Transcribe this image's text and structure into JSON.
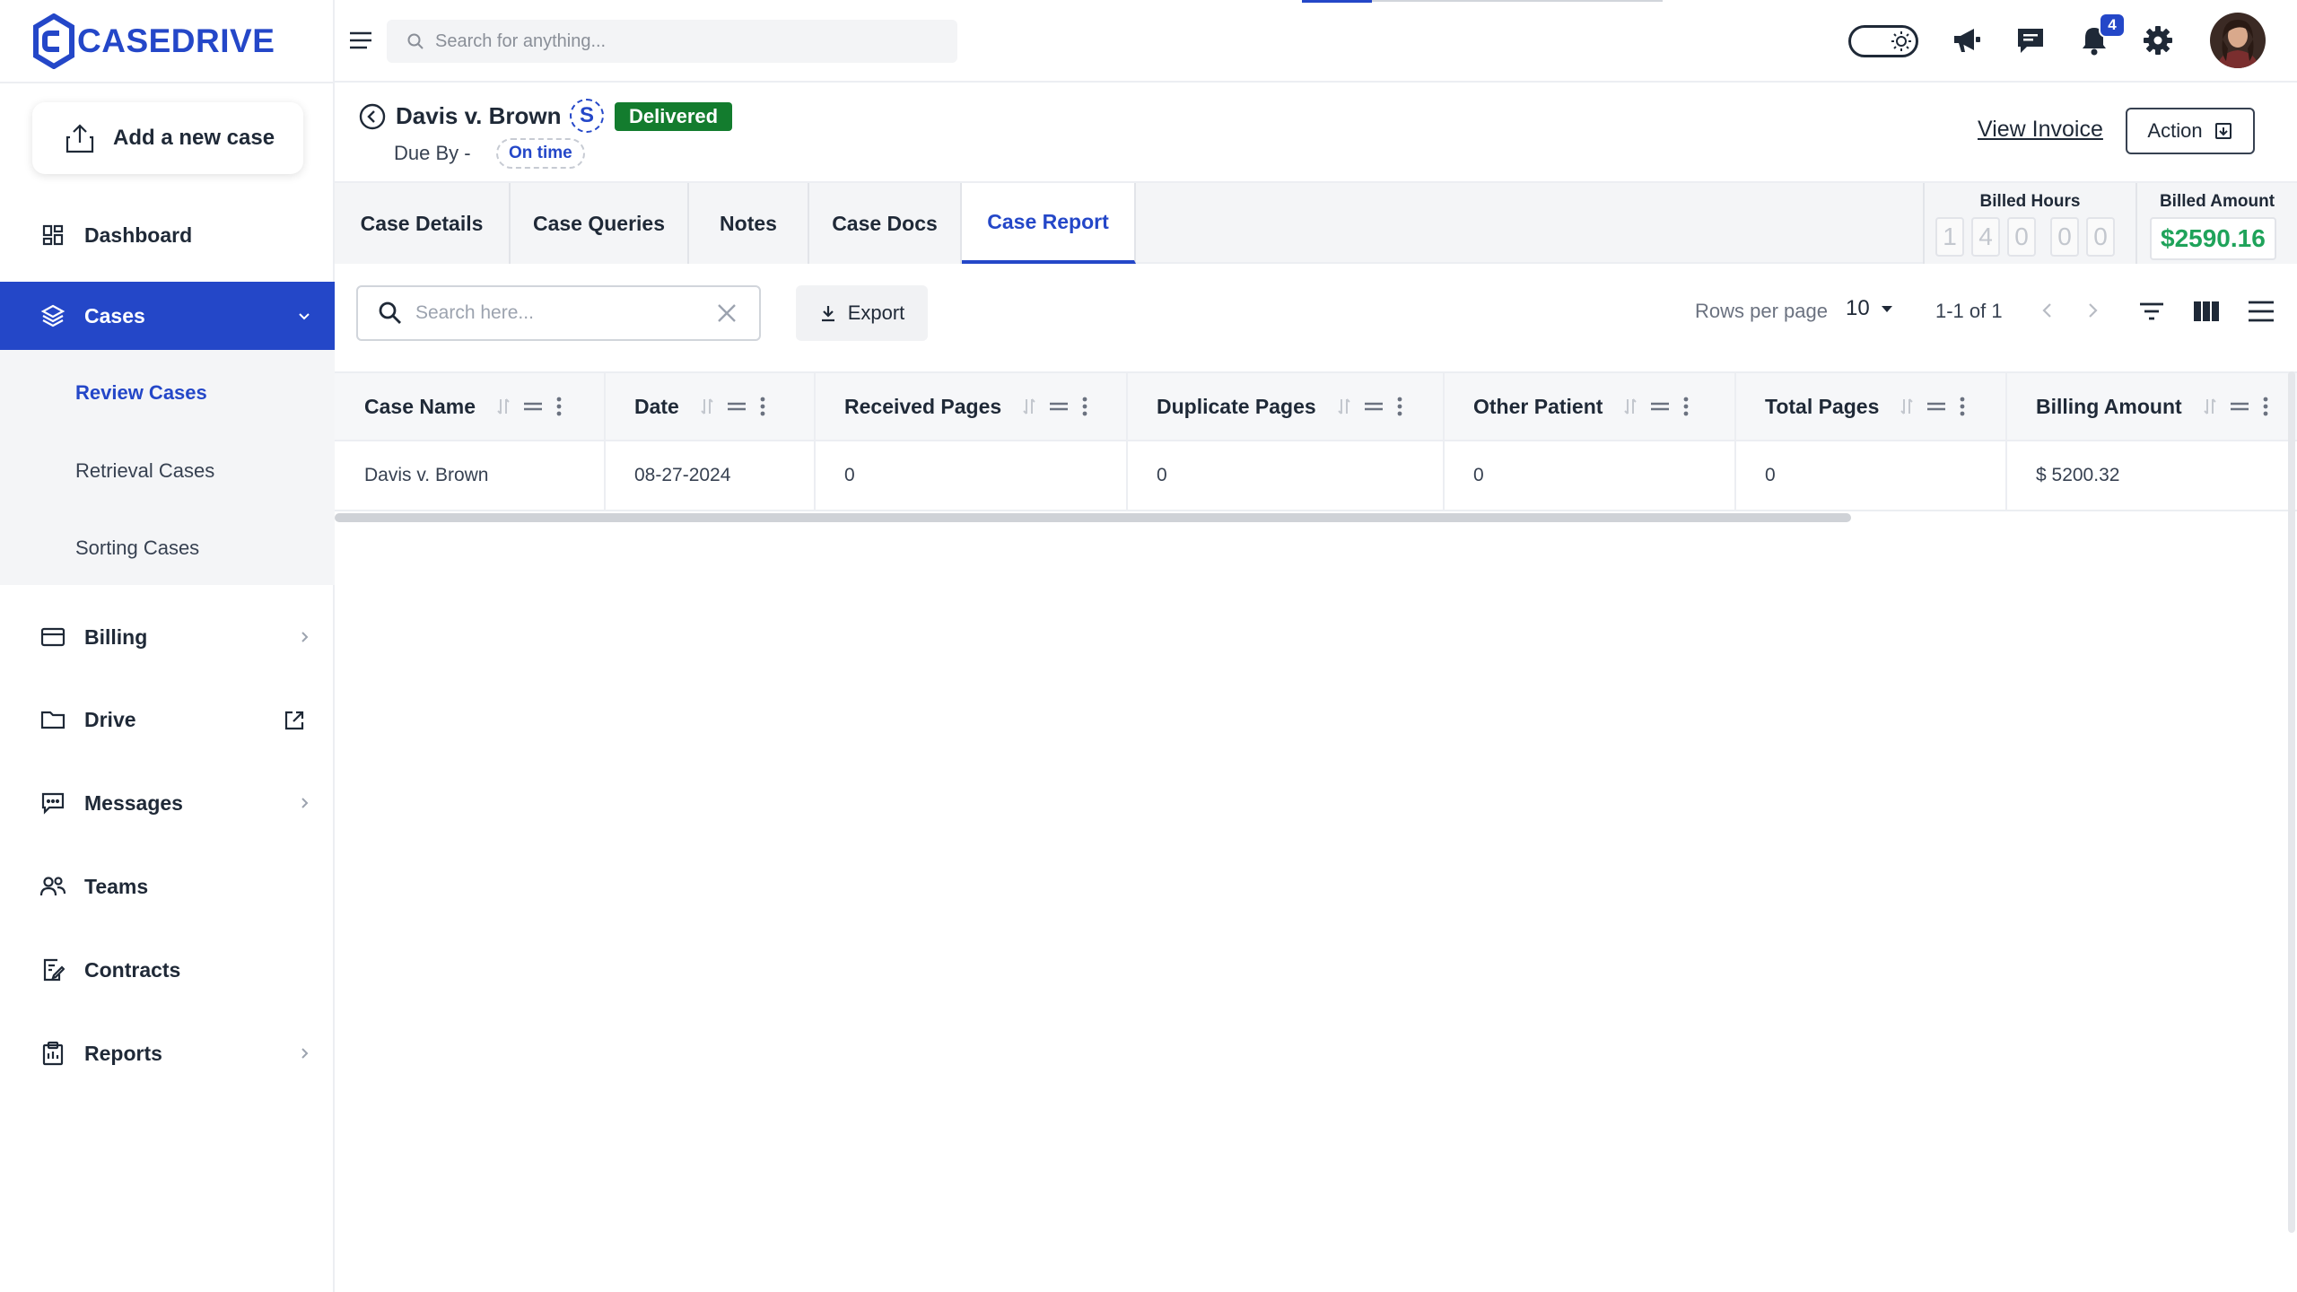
{
  "brand": {
    "name": "CASEDRIVE",
    "accent": "#2447c8"
  },
  "sidebar": {
    "add_case_label": "Add a new case",
    "items": [
      {
        "label": "Dashboard",
        "icon": "dashboard-icon"
      },
      {
        "label": "Cases",
        "icon": "layers-icon",
        "active": true
      },
      {
        "label": "Billing",
        "icon": "credit-card-icon"
      },
      {
        "label": "Drive",
        "icon": "folder-icon"
      },
      {
        "label": "Messages",
        "icon": "message-icon"
      },
      {
        "label": "Teams",
        "icon": "team-icon"
      },
      {
        "label": "Contracts",
        "icon": "contract-icon"
      },
      {
        "label": "Reports",
        "icon": "clipboard-icon"
      }
    ],
    "sub_items": [
      {
        "label": "Review Cases",
        "active": true
      },
      {
        "label": "Retrieval Cases"
      },
      {
        "label": "Sorting Cases"
      }
    ]
  },
  "topbar": {
    "search_placeholder": "Search for anything...",
    "notification_count": "4"
  },
  "case": {
    "title": "Davis v. Brown",
    "initial": "S",
    "status": "Delivered",
    "due_by_label": "Due By -",
    "due_status": "On time",
    "view_invoice_label": "View Invoice",
    "action_label": "Action"
  },
  "tabs": [
    "Case Details",
    "Case Queries",
    "Notes",
    "Case Docs",
    "Case Report"
  ],
  "active_tab": "Case Report",
  "billed": {
    "hours_label": "Billed Hours",
    "hours_digits": [
      "1",
      "4",
      "0",
      "0",
      "0"
    ],
    "amount_label": "Billed Amount",
    "amount": "$2590.16"
  },
  "toolbar": {
    "search_placeholder": "Search here...",
    "export_label": "Export",
    "rows_per_page_label": "Rows per page",
    "rows_per_page_value": "10",
    "pagination_text": "1-1 of 1"
  },
  "table": {
    "columns": [
      "Case Name",
      "Date",
      "Received Pages",
      "Duplicate Pages",
      "Other Patient",
      "Total Pages",
      "Billing Amount"
    ],
    "rows": [
      [
        "Davis v. Brown",
        "08-27-2024",
        "0",
        "0",
        "0",
        "0",
        "$ 5200.32"
      ]
    ]
  }
}
